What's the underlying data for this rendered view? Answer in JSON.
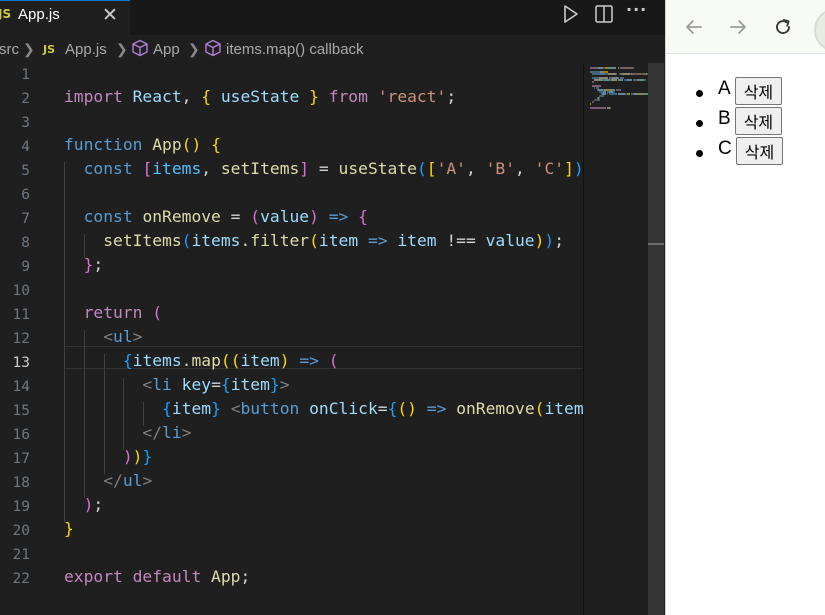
{
  "editor": {
    "tab": {
      "icon": "JS",
      "label": "App.js"
    },
    "breadcrumbs": [
      "src",
      "App.js",
      "App",
      "items.map() callback"
    ],
    "current_line": 13,
    "lines": [
      [],
      [
        [
          "kc",
          "import "
        ],
        [
          "vr",
          "React"
        ],
        [
          "tx",
          ", "
        ],
        [
          "b1",
          "{ "
        ],
        [
          "vr",
          "useState"
        ],
        [
          "b1",
          " }"
        ],
        [
          "kc",
          " from "
        ],
        [
          "st",
          "'react'"
        ],
        [
          "tx",
          ";"
        ]
      ],
      [],
      [
        [
          "kw",
          "function "
        ],
        [
          "fn",
          "App"
        ],
        [
          "b1",
          "() {"
        ]
      ],
      [
        [
          "tx",
          "  "
        ],
        [
          "kw",
          "const "
        ],
        [
          "b2",
          "["
        ],
        [
          "cn",
          "items"
        ],
        [
          "tx",
          ", "
        ],
        [
          "fn",
          "setItems"
        ],
        [
          "b2",
          "]"
        ],
        [
          "tx",
          " = "
        ],
        [
          "fn",
          "useState"
        ],
        [
          "b3",
          "("
        ],
        [
          "b1",
          "["
        ],
        [
          "st",
          "'A'"
        ],
        [
          "tx",
          ", "
        ],
        [
          "st",
          "'B'"
        ],
        [
          "tx",
          ", "
        ],
        [
          "st",
          "'C'"
        ],
        [
          "b1",
          "]"
        ],
        [
          "b3",
          ")"
        ],
        [
          "tx",
          ";"
        ]
      ],
      [],
      [
        [
          "tx",
          "  "
        ],
        [
          "kw",
          "const "
        ],
        [
          "fn",
          "onRemove"
        ],
        [
          "tx",
          " = "
        ],
        [
          "b2",
          "("
        ],
        [
          "vr",
          "value"
        ],
        [
          "b2",
          ")"
        ],
        [
          "kw",
          " => "
        ],
        [
          "b2",
          "{"
        ]
      ],
      [
        [
          "tx",
          "    "
        ],
        [
          "fn",
          "setItems"
        ],
        [
          "b3",
          "("
        ],
        [
          "vr",
          "items"
        ],
        [
          "tx",
          "."
        ],
        [
          "fn",
          "filter"
        ],
        [
          "b1",
          "("
        ],
        [
          "vr",
          "item"
        ],
        [
          "kw",
          " => "
        ],
        [
          "vr",
          "item"
        ],
        [
          "tx",
          " !== "
        ],
        [
          "vr",
          "value"
        ],
        [
          "b1",
          ")"
        ],
        [
          "b3",
          ")"
        ],
        [
          "tx",
          ";"
        ]
      ],
      [
        [
          "tx",
          "  "
        ],
        [
          "b2",
          "}"
        ],
        [
          "tx",
          ";"
        ]
      ],
      [],
      [
        [
          "tx",
          "  "
        ],
        [
          "kc",
          "return "
        ],
        [
          "b2",
          "("
        ]
      ],
      [
        [
          "tx",
          "    "
        ],
        [
          "ab",
          "<"
        ],
        [
          "tg",
          "ul"
        ],
        [
          "ab",
          ">"
        ]
      ],
      [
        [
          "tx",
          "      "
        ],
        [
          "b3",
          "{"
        ],
        [
          "vr",
          "items"
        ],
        [
          "tx",
          "."
        ],
        [
          "fn",
          "map"
        ],
        [
          "b1",
          "(("
        ],
        [
          "vr",
          "item"
        ],
        [
          "b1",
          ")"
        ],
        [
          "kw",
          " => "
        ],
        [
          "b2",
          "("
        ]
      ],
      [
        [
          "tx",
          "        "
        ],
        [
          "ab",
          "<"
        ],
        [
          "tg",
          "li "
        ],
        [
          "at",
          "key"
        ],
        [
          "tx",
          "="
        ],
        [
          "b3",
          "{"
        ],
        [
          "vr",
          "item"
        ],
        [
          "b3",
          "}"
        ],
        [
          "ab",
          ">"
        ]
      ],
      [
        [
          "tx",
          "          "
        ],
        [
          "b3",
          "{"
        ],
        [
          "vr",
          "item"
        ],
        [
          "b3",
          "}"
        ],
        [
          "tx",
          " "
        ],
        [
          "ab",
          "<"
        ],
        [
          "tg",
          "button "
        ],
        [
          "at",
          "onClick"
        ],
        [
          "tx",
          "="
        ],
        [
          "b3",
          "{"
        ],
        [
          "b1",
          "()"
        ],
        [
          "kw",
          " => "
        ],
        [
          "fn",
          "onRemove"
        ],
        [
          "b1",
          "("
        ],
        [
          "vr",
          "item"
        ],
        [
          "b1",
          ")"
        ]
      ],
      [
        [
          "tx",
          "        "
        ],
        [
          "ab",
          "</"
        ],
        [
          "tg",
          "li"
        ],
        [
          "ab",
          ">"
        ]
      ],
      [
        [
          "tx",
          "      "
        ],
        [
          "b2",
          ")"
        ],
        [
          "b1",
          ")"
        ],
        [
          "b3",
          "}"
        ]
      ],
      [
        [
          "tx",
          "    "
        ],
        [
          "ab",
          "</"
        ],
        [
          "tg",
          "ul"
        ],
        [
          "ab",
          ">"
        ]
      ],
      [
        [
          "tx",
          "  "
        ],
        [
          "b2",
          ")"
        ],
        [
          "tx",
          ";"
        ]
      ],
      [
        [
          "b1",
          "}"
        ]
      ],
      [],
      [
        [
          "kc",
          "export "
        ],
        [
          "kc",
          "default "
        ],
        [
          "fn",
          "App"
        ],
        [
          "tx",
          ";"
        ]
      ]
    ]
  },
  "preview": {
    "items": [
      {
        "label": "A",
        "button": "삭제"
      },
      {
        "label": "B",
        "button": "삭제"
      },
      {
        "label": "C",
        "button": "삭제"
      }
    ]
  }
}
